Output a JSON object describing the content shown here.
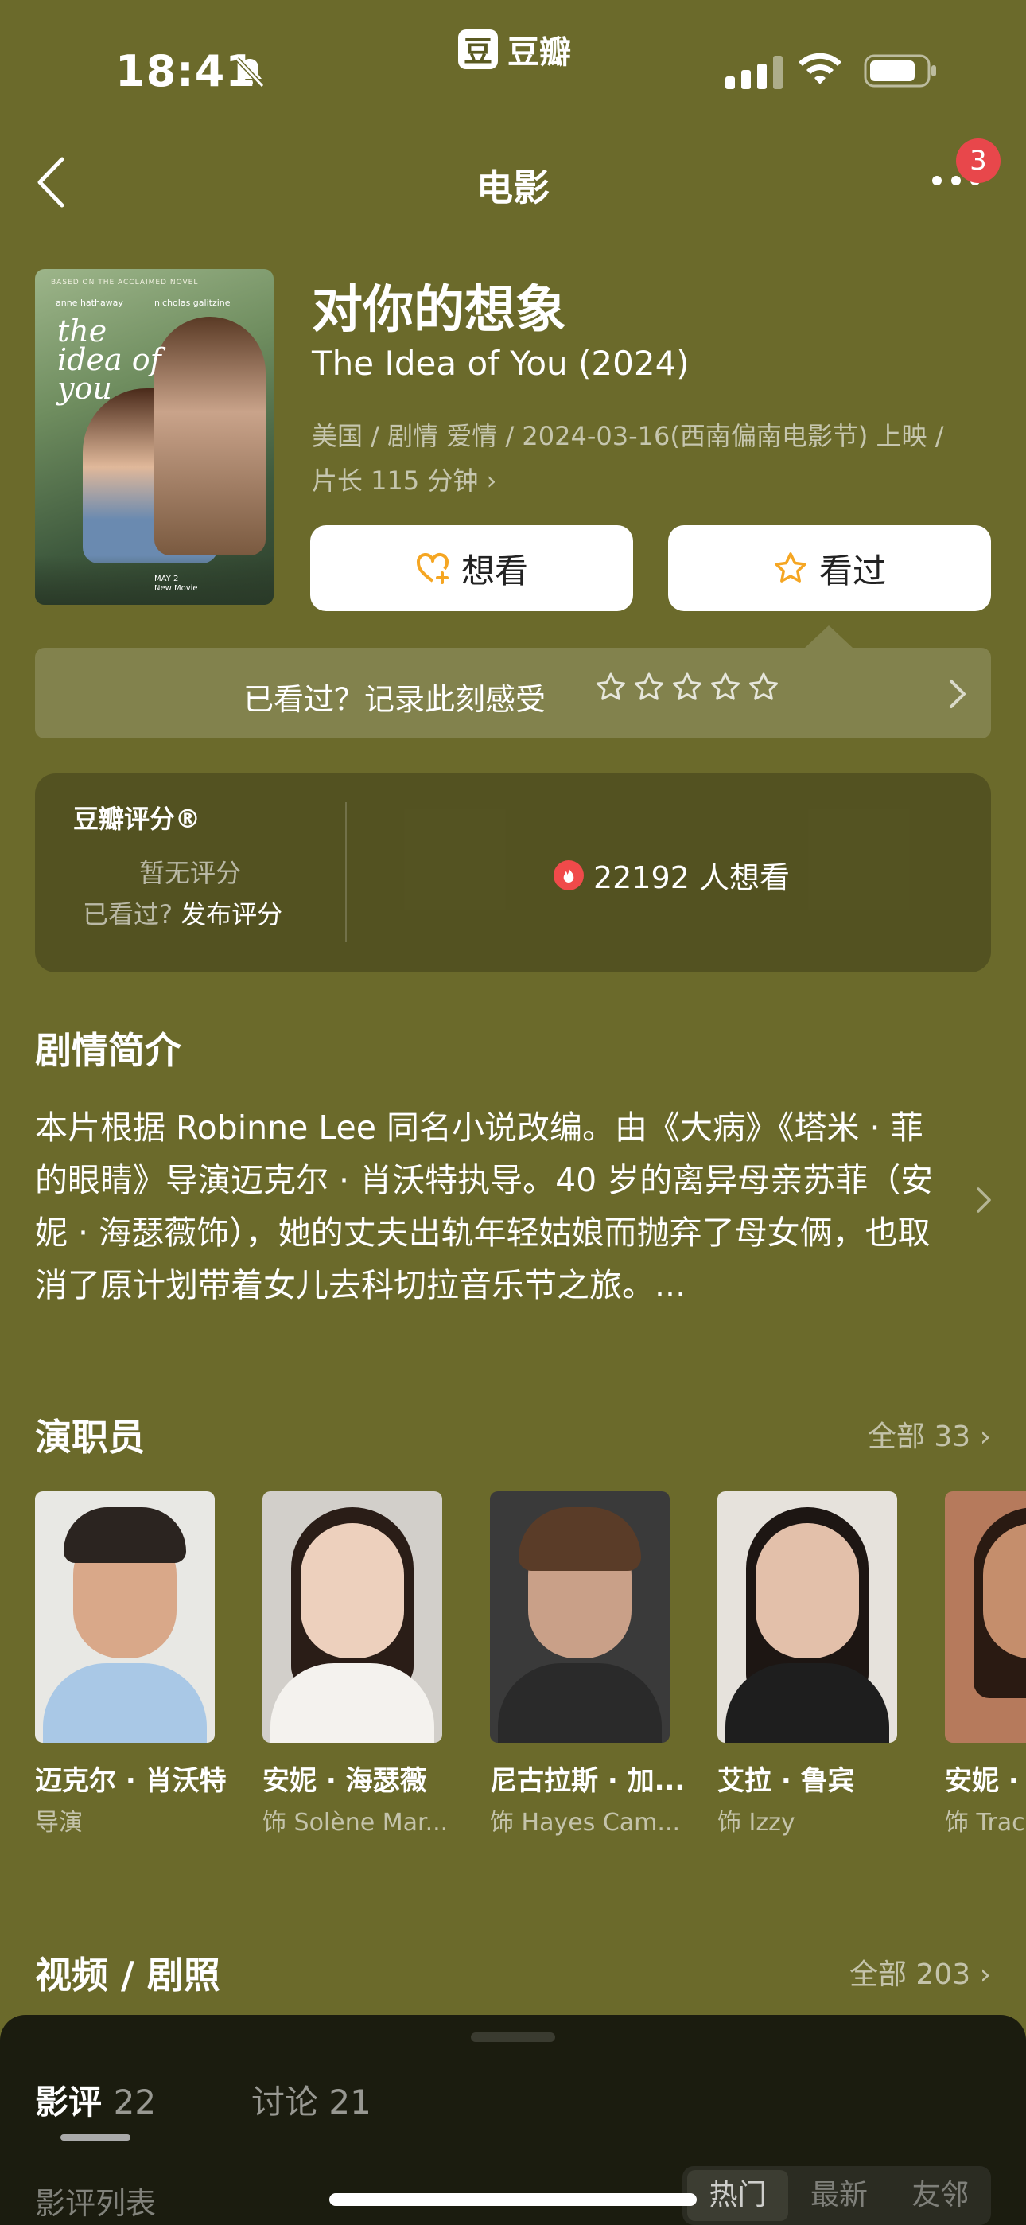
{
  "status": {
    "time": "18:41",
    "app_name": "豆瓣",
    "app_logo_char": "豆"
  },
  "nav": {
    "title": "电影",
    "notification_count": "3"
  },
  "poster": {
    "tagline": "BASED ON THE ACCLAIMED NOVEL",
    "title_line1": "the",
    "title_line2": "idea of",
    "title_line3": "you",
    "actor1": "anne hathaway",
    "actor2": "nicholas galitzine",
    "date": "MAY 2",
    "note": "New Movie"
  },
  "movie": {
    "title_cn": "对你的想象",
    "title_en": "The Idea of You (2024)",
    "meta_line1": "美国 / 剧情 爱情 / 2024-03-16(西南偏南电影节) 上映 /",
    "meta_line2": "片长 115 分钟",
    "want_label": "想看",
    "seen_label": "看过",
    "watched_prompt": "已看过？记录此刻感受"
  },
  "rating": {
    "label": "豆瓣评分®",
    "none": "暂无评分",
    "seen_prefix": "已看过?",
    "seen_action": "发布评分",
    "want_count": "22192 人想看"
  },
  "synopsis": {
    "heading": "剧情简介",
    "text": "本片根据 Robinne Lee 同名小说改编。由《大病》《塔米 · 菲的眼睛》导演迈克尔 · 肖沃特执导。40 岁的离异母亲苏菲（安妮 · 海瑟薇饰），她的丈夫出轨年轻姑娘而抛弃了母女俩，也取消了原计划带着女儿去科切拉音乐节之旅。..."
  },
  "cast": {
    "heading": "演职员",
    "all_link": "全部 33",
    "people": [
      {
        "name": "迈克尔 · 肖沃特",
        "role": "导演"
      },
      {
        "name": "安妮 · 海瑟薇",
        "role": "饰 Solène Mar..."
      },
      {
        "name": "尼古拉斯 · 加...",
        "role": "饰 Hayes Cam..."
      },
      {
        "name": "艾拉 · 鲁宾",
        "role": "饰 Izzy"
      },
      {
        "name": "安妮 ·",
        "role": "饰 Trac"
      }
    ]
  },
  "media": {
    "heading": "视频 / 剧照",
    "all_link": "全部 203"
  },
  "sheet": {
    "tab_reviews": "影评",
    "tab_reviews_count": "22",
    "tab_discuss": "讨论 21",
    "list_label": "影评列表",
    "seg": [
      "热门",
      "最新",
      "友邻"
    ]
  },
  "colors": {
    "background": "#6b6a2b",
    "sheet": "#1b1c0f",
    "accent_star": "#f5a623",
    "badge": "#e8474b"
  }
}
